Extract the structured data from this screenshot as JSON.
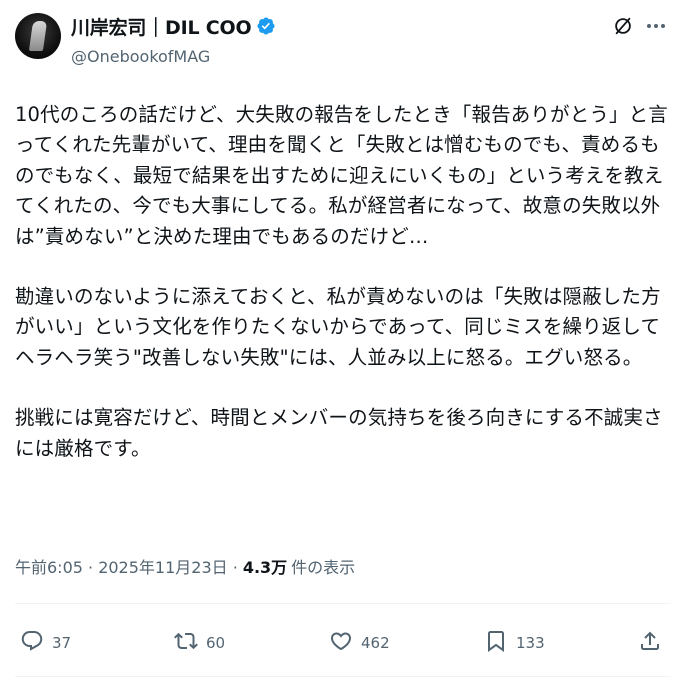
{
  "author": {
    "display_name": "川岸宏司｜DIL COO",
    "handle": "@OnebookofMAG"
  },
  "body": {
    "paragraphs": [
      {
        "lines": [
          "10代のころの話だけど、大失敗の報告をしたとき「報告ありがとう」と言",
          "ってくれた先輩がいて、理由を聞くと「失敗とは憎むものでも、責めるも",
          "のでもなく、最短で結果を出すために迎えにいくもの」という考えを教え",
          "てくれたの、今でも大事にしてる。私が経営者になって、故意の失敗以外",
          "は”責めない”と決めた理由でもあるのだけど…"
        ]
      },
      {
        "lines": [
          "勘違いのないように添えておくと、私が責めないのは「失敗は隠蔽した方",
          "がいい」という文化を作りたくないからであって、同じミスを繰り返して",
          "ヘラヘラ笑う\"改善しない失敗\"には、人並み以上に怒る。エグい怒る。"
        ]
      },
      {
        "lines": [
          "挑戦には寛容だけど、時間とメンバーの気持ちを後ろ向きにする不誠実さ",
          "には厳格です。"
        ]
      }
    ]
  },
  "meta": {
    "timestamp": "午前6:05 · 2025年11月23日 ·",
    "views_count": "4.3万",
    "views_label": "件の表示"
  },
  "actions": {
    "replies": "37",
    "reposts": "60",
    "likes": "462",
    "bookmarks": "133"
  },
  "icons": {
    "verified": "verified-badge-icon",
    "grok": "grok-icon",
    "more": "more-icon",
    "reply": "reply-icon",
    "repost": "repost-icon",
    "like": "like-icon",
    "bookmark": "bookmark-icon",
    "share": "share-icon"
  },
  "colors": {
    "text_primary": "#0f1419",
    "text_secondary": "#536471",
    "verified_blue": "#1d9bf0",
    "divider": "#eff3f4"
  }
}
